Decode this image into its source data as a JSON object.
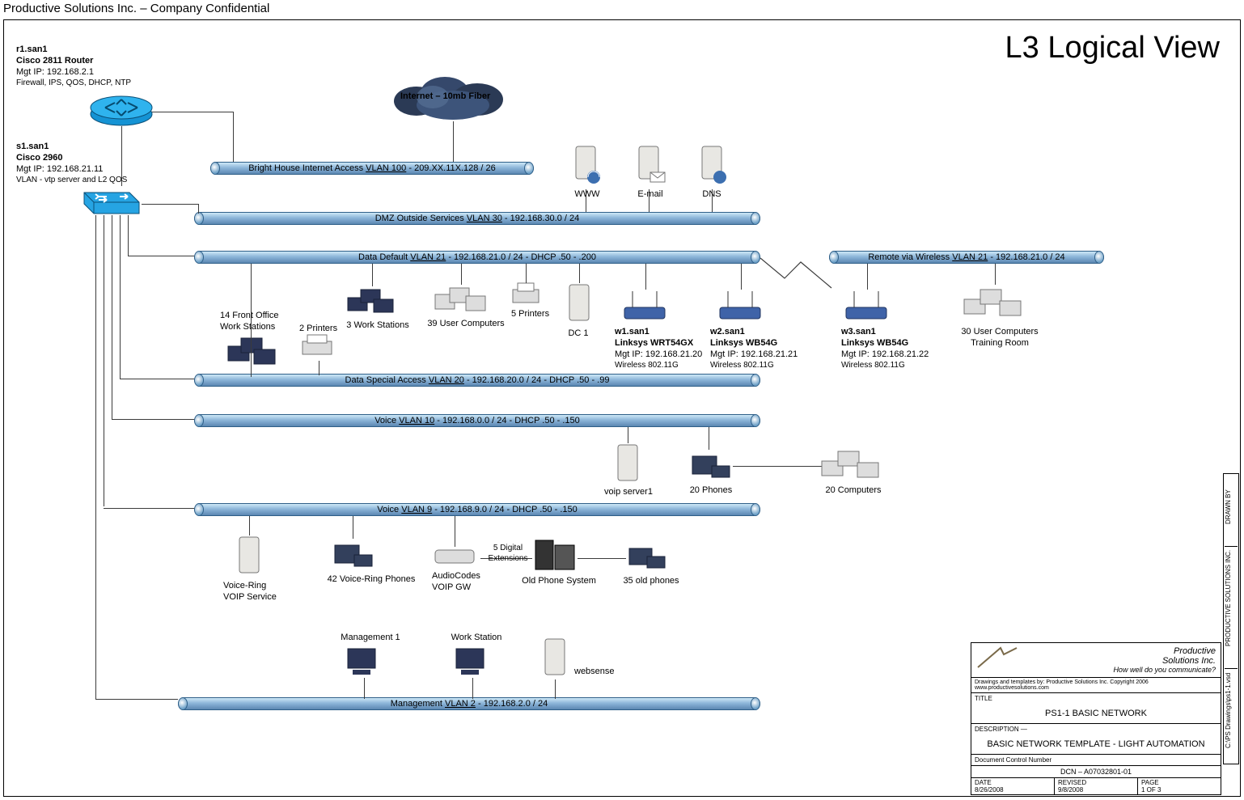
{
  "header": {
    "confidential": "Productive Solutions Inc. – Company Confidential"
  },
  "title": "L3 Logical View",
  "router": {
    "name": "r1.san1",
    "model": "Cisco 2811 Router",
    "mgt": "Mgt IP: 192.168.2.1",
    "feat": "Firewall, IPS, QOS, DHCP, NTP"
  },
  "switch": {
    "name": "s1.san1",
    "model": "Cisco 2960",
    "mgt": "Mgt IP: 192.168.21.11",
    "feat": "VLAN - vtp server and L2 QOS"
  },
  "cloud": {
    "label": "Internet – 10mb Fiber"
  },
  "vlans": {
    "v100": {
      "prefix": "Bright House Internet Access ",
      "vlan": "VLAN 100",
      "suffix": " - 209.XX.11X.128 / 26"
    },
    "v30": {
      "prefix": "DMZ Outside Services ",
      "vlan": "VLAN 30",
      "suffix": " - 192.168.30.0 / 24"
    },
    "v21": {
      "prefix": "Data Default ",
      "vlan": "VLAN 21",
      "suffix": " - 192.168.21.0 / 24  - DHCP .50 - .200"
    },
    "v21r": {
      "prefix": "Remote via Wireless ",
      "vlan": "VLAN 21",
      "suffix": " - 192.168.21.0 / 24"
    },
    "v20": {
      "prefix": "Data Special Access ",
      "vlan": "VLAN 20",
      "suffix": " - 192.168.20.0 / 24  - DHCP .50 - .99"
    },
    "v10": {
      "prefix": "Voice ",
      "vlan": "VLAN 10",
      "suffix": " - 192.168.0.0 / 24  - DHCP .50 - .150"
    },
    "v9": {
      "prefix": "Voice ",
      "vlan": "VLAN 9",
      "suffix": " - 192.168.9.0 / 24  - DHCP .50 - .150"
    },
    "v2": {
      "prefix": "Management ",
      "vlan": "VLAN 2",
      "suffix": " - 192.168.2.0 / 24"
    }
  },
  "dmz": {
    "www": "WWW",
    "email": "E-mail",
    "dns": "DNS"
  },
  "data21": {
    "front_office": "14 Front Office\nWork Stations",
    "two_printers": "2 Printers",
    "three_ws": "3 Work Stations",
    "users": "39 User Computers",
    "five_printers": "5 Printers",
    "dc1": "DC 1"
  },
  "wireless": {
    "w1": {
      "name": "w1.san1",
      "model": "Linksys WRT54GX",
      "mgt": "Mgt IP: 192.168.21.20",
      "std": "Wireless 802.11G"
    },
    "w2": {
      "name": "w2.san1",
      "model": "Linksys WB54G",
      "mgt": "Mgt IP: 192.168.21.21",
      "std": "Wireless 802.11G"
    },
    "w3": {
      "name": "w3.san1",
      "model": "Linksys WB54G",
      "mgt": "Mgt IP: 192.168.21.22",
      "std": "Wireless 802.11G"
    },
    "remote_pcs": "30 User Computers\nTraining Room"
  },
  "voice10": {
    "server": "voip server1",
    "phones20": "20 Phones",
    "pcs20": "20 Computers"
  },
  "voice9": {
    "vr": "Voice-Ring\nVOIP Service",
    "vr_phones": "42 Voice-Ring Phones",
    "gw": "AudioCodes\nVOIP GW",
    "digext": "5 Digital\nExtensions",
    "old_sys": "Old Phone System",
    "old_phones": "35 old phones"
  },
  "mgmt": {
    "m1": "Management 1",
    "ws": "Work Station",
    "web": "websense"
  },
  "titleblock": {
    "logo_name": "Productive\nSolutions Inc.",
    "slogan": "How well do you communicate?",
    "credits": "Drawings and templates by: Productive Solutions Inc. Copyright 2006\nwww.productivesolutions.com",
    "title_hdr": "TITLE",
    "title_val": "PS1-1 BASIC NETWORK",
    "desc_hdr": "DESCRIPTION  —",
    "desc_val": "BASIC NETWORK TEMPLATE - LIGHT AUTOMATION",
    "dcn_hdr": "Document Control Number",
    "dcn_val": "DCN – A07032801-01",
    "date_hdr": "DATE",
    "date_val": "8/26/2008",
    "rev_hdr": "REVISED",
    "rev_val": "9/8/2008",
    "page_hdr": "PAGE",
    "page_val": "1 OF 3"
  },
  "sidebar": {
    "path": "C:\\PS Drawings\\ps1-1.vsd",
    "company": "PRODUCTIVE SOLUTIONS INC.",
    "drawn": "DRAWN BY"
  }
}
